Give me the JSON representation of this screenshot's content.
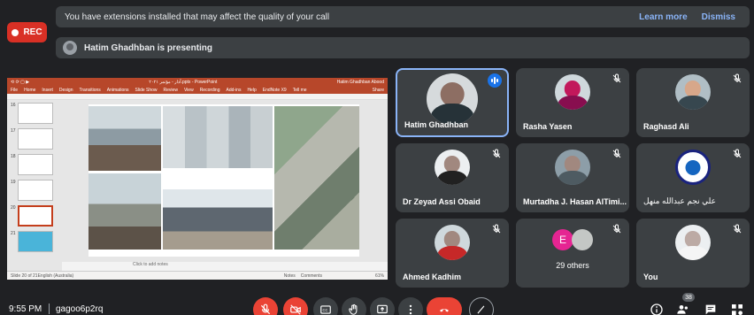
{
  "recording": {
    "label": "REC"
  },
  "notifications": {
    "extensions": {
      "text": "You have extensions installed that may affect the quality of your call",
      "learn_more": "Learn more",
      "dismiss": "Dismiss"
    },
    "presenting": {
      "text": "Hatim Ghadhban is presenting"
    }
  },
  "presentation": {
    "app_title_left": "۲۰۲۱ آذار - مؤتمر.pptx - PowerPoint",
    "app_title_right": "Hatim Ghadhban Abood",
    "menu": [
      "File",
      "Home",
      "Insert",
      "Design",
      "Transitions",
      "Animations",
      "Slide Show",
      "Review",
      "View",
      "Recording",
      "Add-ins",
      "Help",
      "EndNote X9",
      "Tell me"
    ],
    "share": "Share",
    "thumb_numbers": [
      "16",
      "17",
      "18",
      "19",
      "20",
      "21"
    ],
    "notes_placeholder": "Click to add notes",
    "status_left": "Slide 20 of 21",
    "status_lang": "English (Australia)",
    "status_notes": "Notes",
    "status_comments": "Comments",
    "zoom": "61%"
  },
  "participants": [
    {
      "name": "Hatim Ghadhban",
      "state": "speaking"
    },
    {
      "name": "Rasha Yasen",
      "state": "muted"
    },
    {
      "name": "Raghasd Ali",
      "state": "muted"
    },
    {
      "name": "Dr Zeyad Assi Obaid",
      "state": "muted"
    },
    {
      "name": "Murtadha J. Hasan AlTimi...",
      "state": "muted"
    },
    {
      "name": "علي نجم عبدالله منهل",
      "state": "muted"
    },
    {
      "name": "Ahmed Kadhim",
      "state": "muted"
    },
    {
      "name": "29 others",
      "initial": "E",
      "state": "muted"
    },
    {
      "name": "You",
      "state": "muted"
    }
  ],
  "bottom_bar": {
    "time": "9:55 PM",
    "meeting_code": "gagoo6p2rq",
    "participant_count": "38",
    "controls": [
      "mic-off",
      "camera-off",
      "captions",
      "raise-hand",
      "present",
      "more",
      "leave",
      "annotate"
    ]
  },
  "colors": {
    "background": "#202124",
    "tile": "#3c4043",
    "danger": "#ea4335",
    "accent": "#8ab4f8",
    "speaking": "#1a73e8",
    "powerpoint": "#b7472a"
  }
}
